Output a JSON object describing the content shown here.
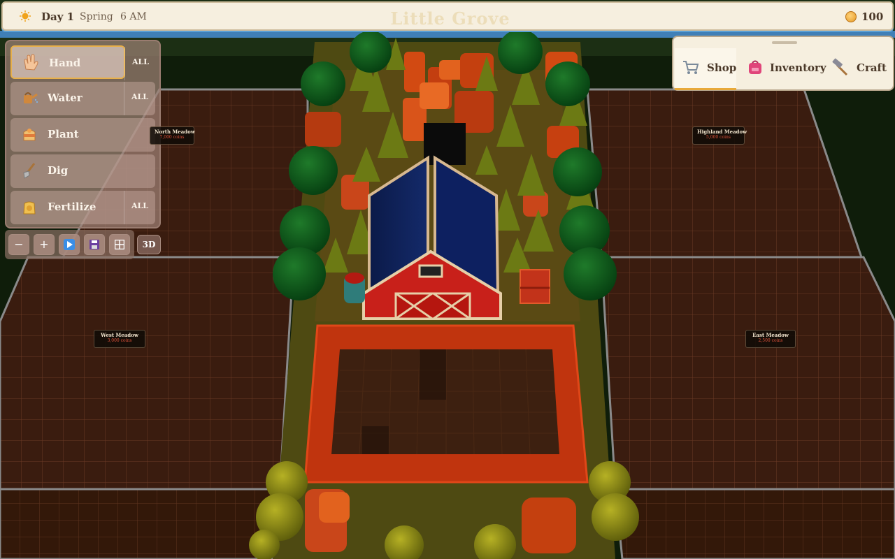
{
  "top_bar": {
    "day": "Day 1",
    "season": "Spring",
    "time": "6 AM",
    "title": "Little Grove",
    "coins": "100"
  },
  "tools": [
    {
      "label": "Hand",
      "all": "ALL",
      "icon": "hand-icon",
      "active": true
    },
    {
      "label": "Water",
      "all": "ALL",
      "icon": "watering-can-icon"
    },
    {
      "label": "Plant",
      "all": "",
      "icon": "seed-bag-icon"
    },
    {
      "label": "Dig",
      "all": "",
      "icon": "shovel-icon"
    },
    {
      "label": "Fertilize",
      "all": "ALL",
      "icon": "fertilizer-bag-icon"
    }
  ],
  "controls": {
    "zoom_out": "−",
    "zoom_in": "+",
    "view_3d": "3D"
  },
  "shop_tabs": [
    {
      "label": "Shop",
      "icon": "cart-icon",
      "active": true
    },
    {
      "label": "Inventory",
      "icon": "backpack-icon"
    },
    {
      "label": "Craft",
      "icon": "hammer-icon"
    }
  ],
  "regions": {
    "north": {
      "name": "North Meadow",
      "price": "7,000 coins"
    },
    "highland": {
      "name": "Highland Meadow",
      "price": "5,000 coins"
    },
    "west": {
      "name": "West Meadow",
      "price": "3,000 coins"
    },
    "east": {
      "name": "East Meadow",
      "price": "2,500 coins"
    }
  },
  "colors": {
    "accent": "#e8b04a",
    "panel_cream": "#f6efdf",
    "barn_red": "#c8201a",
    "roof_blue": "#0c1e52",
    "price_red": "#e0523a"
  }
}
